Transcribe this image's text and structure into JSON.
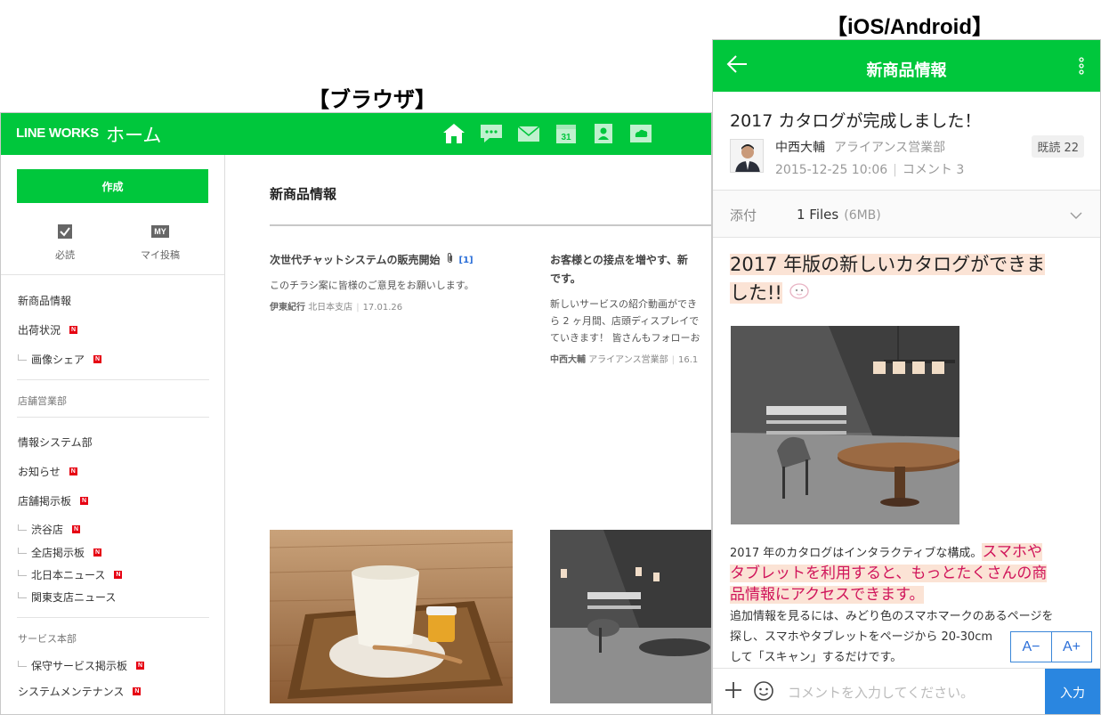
{
  "captions": {
    "browser": "【ブラウザ】",
    "mobile": "【iOS/Android】"
  },
  "browser": {
    "logo": "LINE WORKS",
    "app_title": "ホーム",
    "nav_icons": [
      "home-icon",
      "talk-icon",
      "mail-icon",
      "calendar-icon",
      "contacts-icon",
      "drive-icon"
    ],
    "compose_label": "作成",
    "quick_links": [
      {
        "icon": "checkbox-icon",
        "label": "必読"
      },
      {
        "icon": "my-icon",
        "icon_text": "MY",
        "label": "マイ投稿"
      }
    ],
    "sidebar": {
      "item_new_products": "新商品情報",
      "item_shipping": "出荷状況",
      "item_image_share": "画像シェア",
      "section_store_sales": "店舗営業部",
      "item_info_systems": "情報システム部",
      "item_notice": "お知らせ",
      "item_store_board": "店舗掲示板",
      "item_shibuya": "渋谷店",
      "item_all_stores": "全店掲示板",
      "item_north_japan": "北日本ニュース",
      "item_kanto": "関東支店ニュース",
      "section_service": "サービス本部",
      "item_maintenance_board": "保守サービス掲示板",
      "item_system_maintenance": "システムメンテナンス",
      "new_badge": "N"
    },
    "section_title": "新商品情報",
    "posts": [
      {
        "title": "次世代チャットシステムの販売開始",
        "comment_count": "[1]",
        "desc": "このチラシ案に皆様のご意見をお願いします。",
        "author": "伊東紀行",
        "dept": "北日本支店",
        "date": "17.01.26"
      },
      {
        "title": "お客様との接点を増やす、新",
        "title2": "です。",
        "desc": "新しいサービスの紹介動画ができ",
        "desc2": "ら 2 ヶ月間、店頭ディスプレイで",
        "desc3": "ていきます！ 皆さんもフォローお",
        "author": "中西大輔",
        "dept": "アライアンス営業部",
        "date": "16.1"
      }
    ]
  },
  "mobile": {
    "header_title": "新商品情報",
    "post_title": "2017 カタログが完成しました！",
    "author_name": "中西大輔",
    "author_dept": "アライアンス営業部",
    "read_badge": "既読 22",
    "date": "2015-12-25 10:06",
    "comments": "コメント 3",
    "attach_label": "添付",
    "attach_files": "1 Files",
    "attach_size": "(6MB)",
    "headline": "2017 年版の新しいカタログができま",
    "headline2": "した!!",
    "body_1": "2017 年のカタログはインタラクティブな構成。",
    "body_hl_1": "スマホや",
    "body_hl_2": "タブレットを利用すると、もっとたくさんの商",
    "body_hl_3": "品情報にアクセスできます。",
    "body_2": "追加情報を見るには、みどり色のスマホマークのあるページを",
    "body_3": "探し、スマホやタブレットをページから 20-30cm",
    "body_4": "して「スキャン」するだけです。",
    "font_minus": "A−",
    "font_plus": "A+",
    "comment_placeholder": "コメントを入力してください。",
    "send_label": "入力"
  }
}
